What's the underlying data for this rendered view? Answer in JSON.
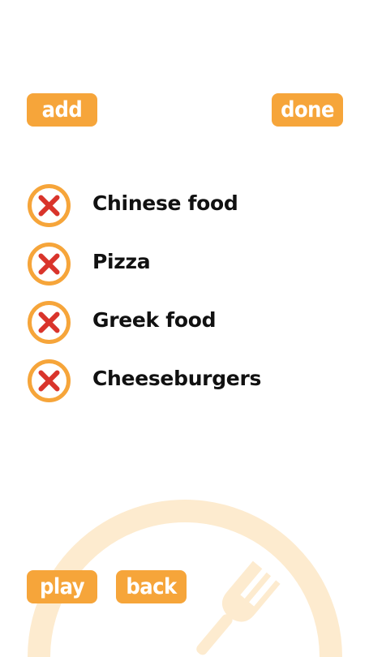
{
  "toolbar": {
    "add_label": "add",
    "done_label": "done"
  },
  "food_items": [
    {
      "label": "Chinese food",
      "remove_icon": "remove-x-icon"
    },
    {
      "label": "Pizza",
      "remove_icon": "remove-x-icon"
    },
    {
      "label": "Greek food",
      "remove_icon": "remove-x-icon"
    },
    {
      "label": "Cheeseburgers",
      "remove_icon": "remove-x-icon"
    }
  ],
  "footer": {
    "play_label": "play",
    "back_label": "back"
  },
  "watermark_icon": "plate-fork-icon",
  "colors": {
    "accent": "#f6a53a",
    "remove_ring": "#f6a53a",
    "remove_x": "#d9342b",
    "text": "#111111",
    "watermark": "#fde9c8"
  }
}
